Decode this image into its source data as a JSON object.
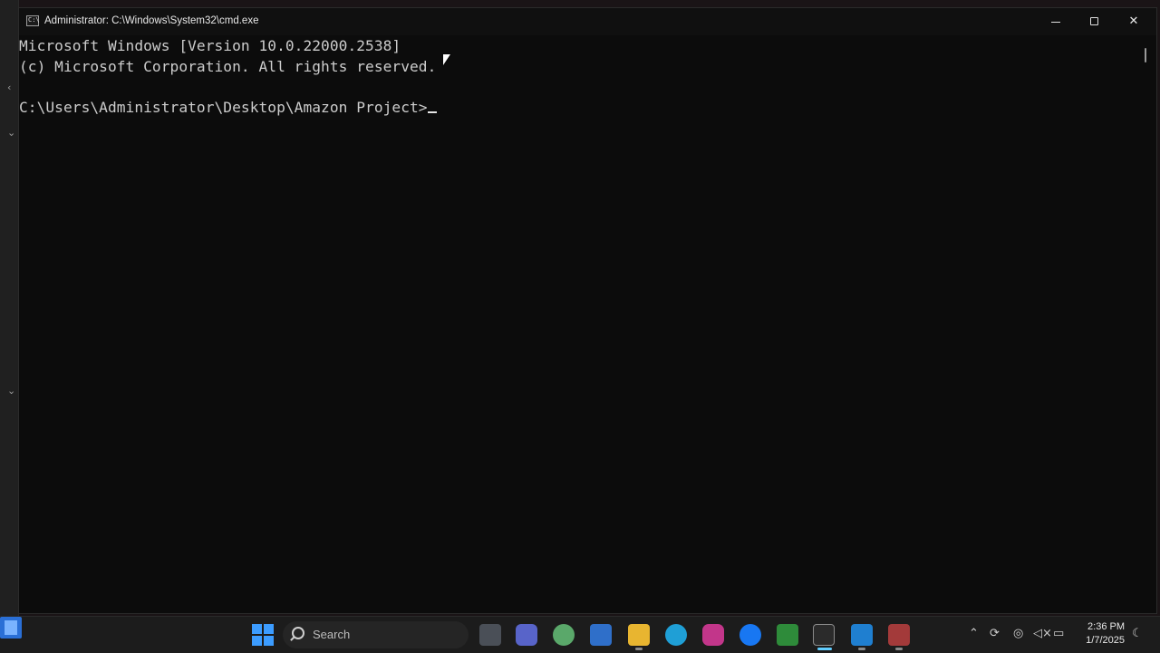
{
  "window": {
    "title": "Administrator: C:\\Windows\\System32\\cmd.exe",
    "icon_label": "C:\\"
  },
  "terminal": {
    "line1": "Microsoft Windows [Version 10.0.22000.2538]",
    "line2": "(c) Microsoft Corporation. All rights reserved.",
    "prompt": "C:\\Users\\Administrator\\Desktop\\Amazon Project>"
  },
  "taskbar": {
    "search_placeholder": "Search",
    "clock_time": "2:36 PM",
    "clock_date": "1/7/2025"
  },
  "icons": {
    "minimize": "minimize-icon",
    "maximize": "maximize-icon",
    "close": "close-icon"
  },
  "colors": {
    "terminal_bg": "#0c0c0c",
    "terminal_fg": "#cccccc",
    "accent": "#60cdff"
  }
}
